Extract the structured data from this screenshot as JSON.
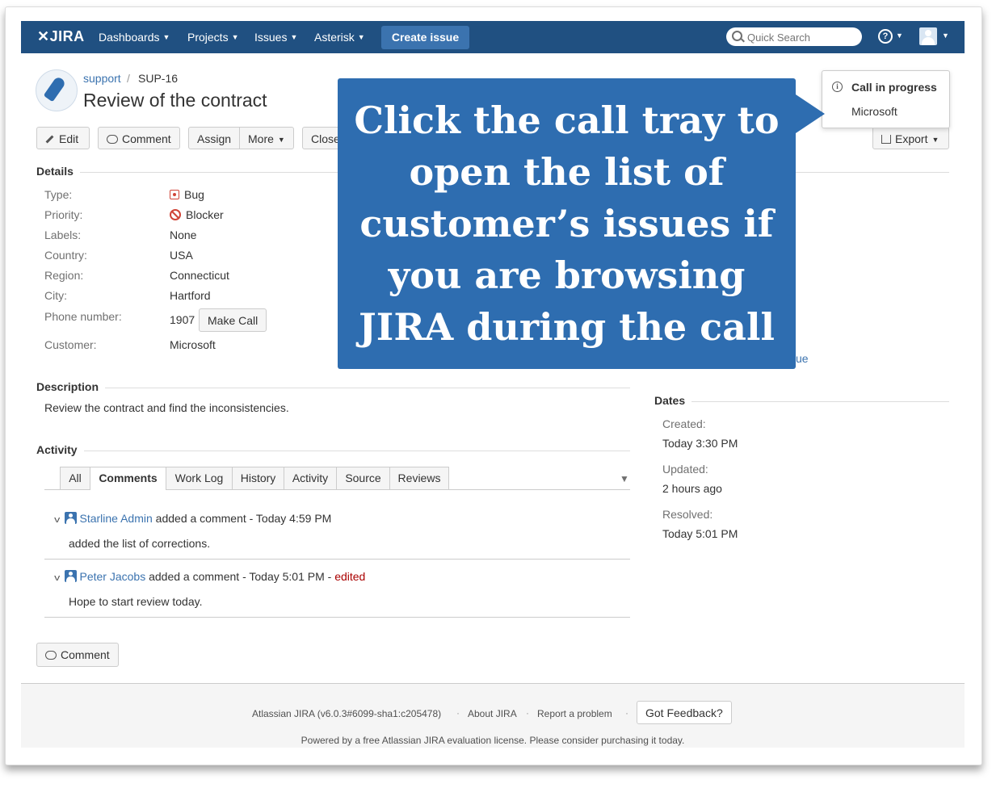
{
  "header": {
    "logo": "JIRA",
    "nav": [
      "Dashboards",
      "Projects",
      "Issues",
      "Asterisk"
    ],
    "create_label": "Create issue",
    "search_placeholder": "Quick Search",
    "help_glyph": "?"
  },
  "issue": {
    "project": "support",
    "separator": "/",
    "key": "SUP-16",
    "title": "Review of the contract"
  },
  "toolbar": {
    "edit": "Edit",
    "comment": "Comment",
    "assign": "Assign",
    "more": "More",
    "close": "Close",
    "export": "Export"
  },
  "details": {
    "title": "Details",
    "fields": [
      {
        "label": "Type:",
        "value": "Bug"
      },
      {
        "label": "Priority:",
        "value": "Blocker"
      },
      {
        "label": "Labels:",
        "value": "None"
      },
      {
        "label": "Country:",
        "value": "USA"
      },
      {
        "label": "Region:",
        "value": "Connecticut"
      },
      {
        "label": "City:",
        "value": "Hartford"
      },
      {
        "label": "Phone number:",
        "value": "1907"
      },
      {
        "label": "Customer:",
        "value": "Microsoft"
      }
    ],
    "make_call": "Make Call"
  },
  "description": {
    "title": "Description",
    "text": "Review the contract and find the inconsistencies."
  },
  "activity": {
    "title": "Activity",
    "tabs": [
      "All",
      "Comments",
      "Work Log",
      "History",
      "Activity",
      "Source",
      "Reviews"
    ],
    "active_tab": "Comments",
    "comments": [
      {
        "author": "Starline Admin",
        "action": " added a comment - Today 4:59 PM",
        "edited": "",
        "body": "added the list of corrections."
      },
      {
        "author": "Peter Jacobs",
        "action": " added a comment - Today 5:01 PM - ",
        "edited": "edited",
        "body": "Hope to start review today."
      }
    ],
    "comment_button": "Comment"
  },
  "people_partial_link": "ue",
  "dates": {
    "title": "Dates",
    "created_label": "Created:",
    "created": "Today 3:30 PM",
    "updated_label": "Updated:",
    "updated": "2 hours ago",
    "resolved_label": "Resolved:",
    "resolved": "Today 5:01 PM"
  },
  "footer": {
    "version": "Atlassian JIRA (v6.0.3#6099-sha1:c205478)",
    "about": "About JIRA",
    "report": "Report a problem",
    "feedback": "Got Feedback?",
    "dot": "·",
    "powered": "Powered by a free Atlassian JIRA evaluation license. Please consider purchasing it today."
  },
  "call_popup": {
    "title": "Call in progress",
    "customer": "Microsoft"
  },
  "callout": {
    "text": "Click the call tray to open the list of customer’s issues if you are browsing JIRA during the call"
  },
  "colors": {
    "header_bg": "#205081",
    "link": "#3b73af",
    "callout_bg": "#2e6db0",
    "blocker": "#d04437"
  }
}
